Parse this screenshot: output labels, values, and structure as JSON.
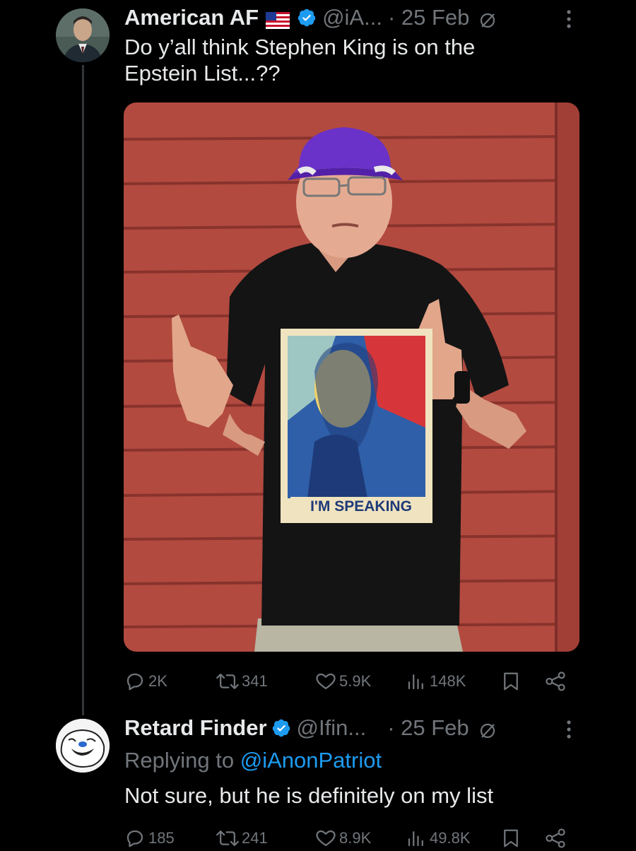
{
  "tweet": {
    "display_name": "American AF",
    "handle": "@iA...",
    "date": "· 25 Feb",
    "text_line1": "Do y’all think Stephen King is on the",
    "text_line2": "Epstein List...??",
    "shirt_caption": "I'M SPEAKING",
    "counts": {
      "replies": "2K",
      "retweets": "341",
      "likes": "5.9K",
      "views": "148K"
    }
  },
  "reply": {
    "display_name": "Retard Finder",
    "handle": "@Ifin...",
    "date": "· 25 Feb",
    "replying_prefix": "Replying to ",
    "replying_to": "@iAnonPatriot",
    "text": "Not sure, but he is definitely on my list",
    "counts": {
      "replies": "185",
      "retweets": "241",
      "likes": "8.9K",
      "views": "49.8K"
    }
  },
  "colors": {
    "background": "#000000",
    "text": "#e7e9ea",
    "muted": "#71767b",
    "accent": "#1d9bf0",
    "wall": "#b24a40"
  },
  "icons": [
    "flag-us-icon",
    "verified-badge-icon",
    "mute-icon",
    "more-icon",
    "reply-icon",
    "retweet-icon",
    "like-icon",
    "views-icon",
    "bookmark-icon",
    "share-icon"
  ]
}
